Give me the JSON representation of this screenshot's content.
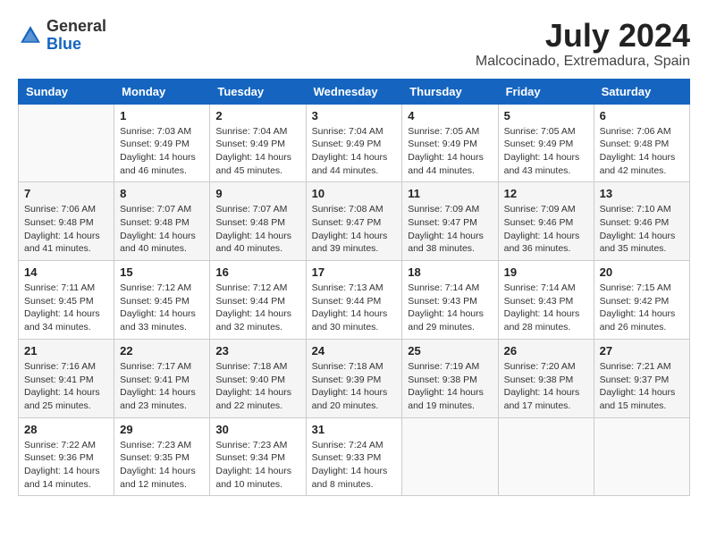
{
  "logo": {
    "general": "General",
    "blue": "Blue"
  },
  "header": {
    "month": "July 2024",
    "location": "Malcocinado, Extremadura, Spain"
  },
  "weekdays": [
    "Sunday",
    "Monday",
    "Tuesday",
    "Wednesday",
    "Thursday",
    "Friday",
    "Saturday"
  ],
  "weeks": [
    [
      {
        "day": "",
        "info": ""
      },
      {
        "day": "1",
        "info": "Sunrise: 7:03 AM\nSunset: 9:49 PM\nDaylight: 14 hours and 46 minutes."
      },
      {
        "day": "2",
        "info": "Sunrise: 7:04 AM\nSunset: 9:49 PM\nDaylight: 14 hours and 45 minutes."
      },
      {
        "day": "3",
        "info": "Sunrise: 7:04 AM\nSunset: 9:49 PM\nDaylight: 14 hours and 44 minutes."
      },
      {
        "day": "4",
        "info": "Sunrise: 7:05 AM\nSunset: 9:49 PM\nDaylight: 14 hours and 44 minutes."
      },
      {
        "day": "5",
        "info": "Sunrise: 7:05 AM\nSunset: 9:49 PM\nDaylight: 14 hours and 43 minutes."
      },
      {
        "day": "6",
        "info": "Sunrise: 7:06 AM\nSunset: 9:48 PM\nDaylight: 14 hours and 42 minutes."
      }
    ],
    [
      {
        "day": "7",
        "info": "Sunrise: 7:06 AM\nSunset: 9:48 PM\nDaylight: 14 hours and 41 minutes."
      },
      {
        "day": "8",
        "info": "Sunrise: 7:07 AM\nSunset: 9:48 PM\nDaylight: 14 hours and 40 minutes."
      },
      {
        "day": "9",
        "info": "Sunrise: 7:07 AM\nSunset: 9:48 PM\nDaylight: 14 hours and 40 minutes."
      },
      {
        "day": "10",
        "info": "Sunrise: 7:08 AM\nSunset: 9:47 PM\nDaylight: 14 hours and 39 minutes."
      },
      {
        "day": "11",
        "info": "Sunrise: 7:09 AM\nSunset: 9:47 PM\nDaylight: 14 hours and 38 minutes."
      },
      {
        "day": "12",
        "info": "Sunrise: 7:09 AM\nSunset: 9:46 PM\nDaylight: 14 hours and 36 minutes."
      },
      {
        "day": "13",
        "info": "Sunrise: 7:10 AM\nSunset: 9:46 PM\nDaylight: 14 hours and 35 minutes."
      }
    ],
    [
      {
        "day": "14",
        "info": "Sunrise: 7:11 AM\nSunset: 9:45 PM\nDaylight: 14 hours and 34 minutes."
      },
      {
        "day": "15",
        "info": "Sunrise: 7:12 AM\nSunset: 9:45 PM\nDaylight: 14 hours and 33 minutes."
      },
      {
        "day": "16",
        "info": "Sunrise: 7:12 AM\nSunset: 9:44 PM\nDaylight: 14 hours and 32 minutes."
      },
      {
        "day": "17",
        "info": "Sunrise: 7:13 AM\nSunset: 9:44 PM\nDaylight: 14 hours and 30 minutes."
      },
      {
        "day": "18",
        "info": "Sunrise: 7:14 AM\nSunset: 9:43 PM\nDaylight: 14 hours and 29 minutes."
      },
      {
        "day": "19",
        "info": "Sunrise: 7:14 AM\nSunset: 9:43 PM\nDaylight: 14 hours and 28 minutes."
      },
      {
        "day": "20",
        "info": "Sunrise: 7:15 AM\nSunset: 9:42 PM\nDaylight: 14 hours and 26 minutes."
      }
    ],
    [
      {
        "day": "21",
        "info": "Sunrise: 7:16 AM\nSunset: 9:41 PM\nDaylight: 14 hours and 25 minutes."
      },
      {
        "day": "22",
        "info": "Sunrise: 7:17 AM\nSunset: 9:41 PM\nDaylight: 14 hours and 23 minutes."
      },
      {
        "day": "23",
        "info": "Sunrise: 7:18 AM\nSunset: 9:40 PM\nDaylight: 14 hours and 22 minutes."
      },
      {
        "day": "24",
        "info": "Sunrise: 7:18 AM\nSunset: 9:39 PM\nDaylight: 14 hours and 20 minutes."
      },
      {
        "day": "25",
        "info": "Sunrise: 7:19 AM\nSunset: 9:38 PM\nDaylight: 14 hours and 19 minutes."
      },
      {
        "day": "26",
        "info": "Sunrise: 7:20 AM\nSunset: 9:38 PM\nDaylight: 14 hours and 17 minutes."
      },
      {
        "day": "27",
        "info": "Sunrise: 7:21 AM\nSunset: 9:37 PM\nDaylight: 14 hours and 15 minutes."
      }
    ],
    [
      {
        "day": "28",
        "info": "Sunrise: 7:22 AM\nSunset: 9:36 PM\nDaylight: 14 hours and 14 minutes."
      },
      {
        "day": "29",
        "info": "Sunrise: 7:23 AM\nSunset: 9:35 PM\nDaylight: 14 hours and 12 minutes."
      },
      {
        "day": "30",
        "info": "Sunrise: 7:23 AM\nSunset: 9:34 PM\nDaylight: 14 hours and 10 minutes."
      },
      {
        "day": "31",
        "info": "Sunrise: 7:24 AM\nSunset: 9:33 PM\nDaylight: 14 hours and 8 minutes."
      },
      {
        "day": "",
        "info": ""
      },
      {
        "day": "",
        "info": ""
      },
      {
        "day": "",
        "info": ""
      }
    ]
  ]
}
